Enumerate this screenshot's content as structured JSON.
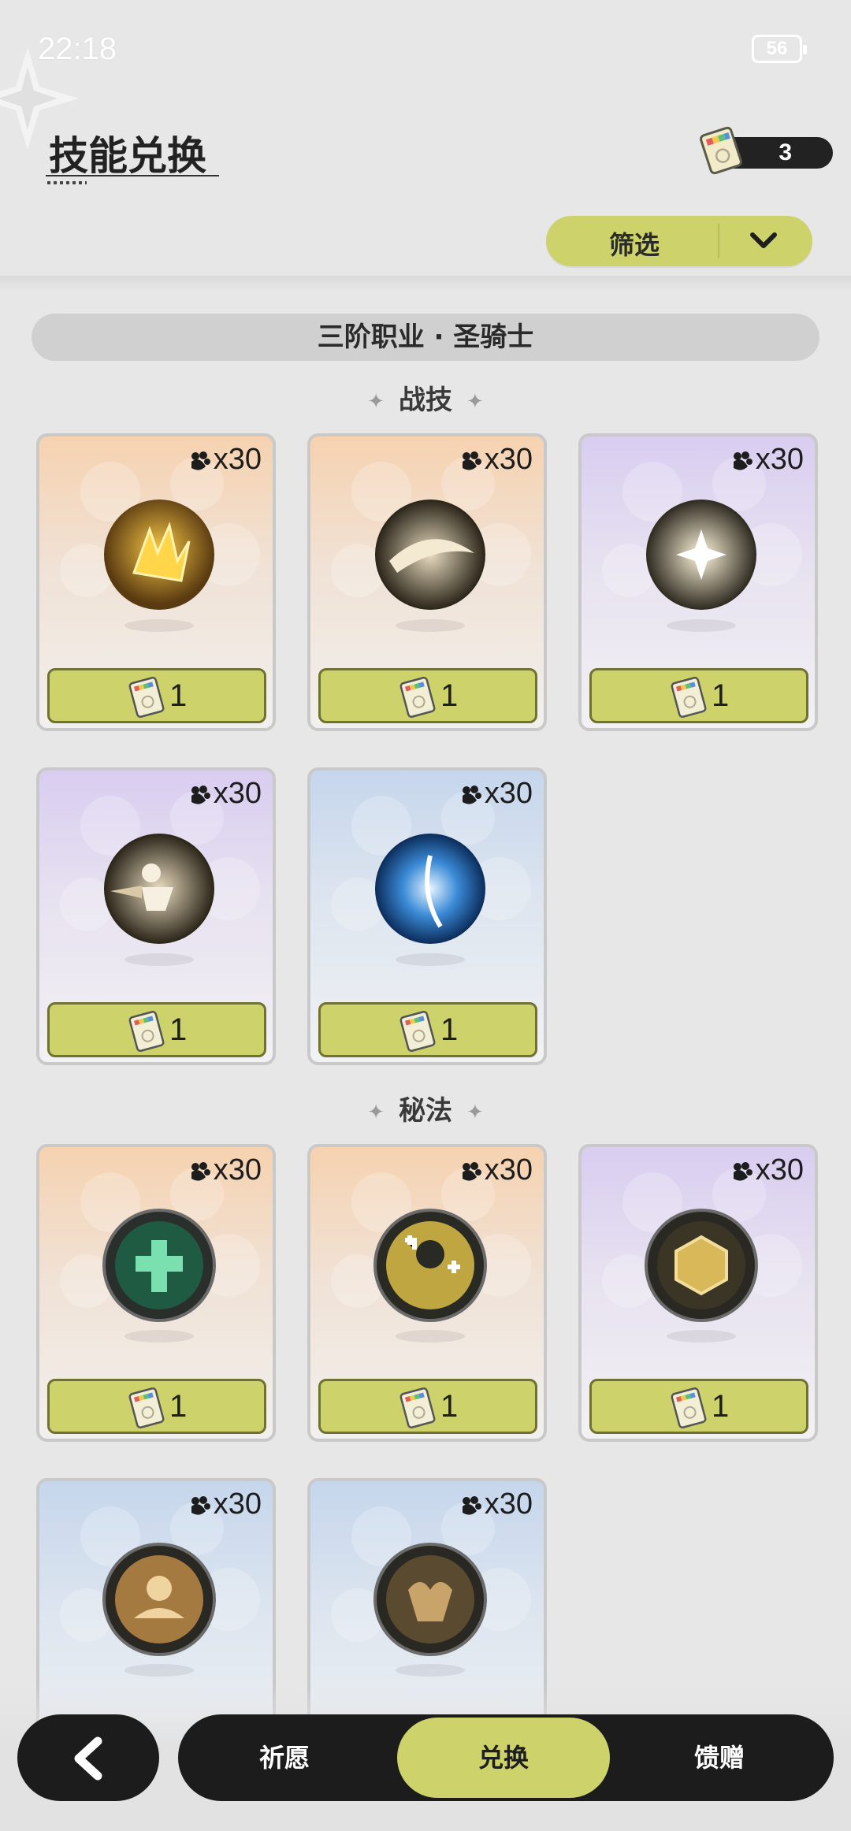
{
  "status_bar": {
    "time": "22:18",
    "battery": "56"
  },
  "header": {
    "title": "技能兑换",
    "currency_count": "3"
  },
  "filter": {
    "label": "筛选"
  },
  "section": {
    "title": "三阶职业 · 圣骑士"
  },
  "groups": [
    {
      "label": "战技",
      "cards": [
        {
          "cost": "x30",
          "price": "1",
          "theme": "orange",
          "icon": "sword-flame-skill-icon"
        },
        {
          "cost": "x30",
          "price": "1",
          "theme": "orange",
          "icon": "slash-wave-skill-icon"
        },
        {
          "cost": "x30",
          "price": "1",
          "theme": "purple",
          "icon": "star-burst-skill-icon"
        },
        {
          "cost": "x30",
          "price": "1",
          "theme": "purple",
          "icon": "dash-strike-skill-icon"
        },
        {
          "cost": "x30",
          "price": "1",
          "theme": "blue",
          "icon": "ice-vortex-skill-icon"
        }
      ]
    },
    {
      "label": "秘法",
      "cards": [
        {
          "cost": "x30",
          "price": "1",
          "theme": "orange",
          "icon": "holy-cross-skill-icon"
        },
        {
          "cost": "x30",
          "price": "1",
          "theme": "orange",
          "icon": "heal-ally-skill-icon"
        },
        {
          "cost": "x30",
          "price": "1",
          "theme": "purple",
          "icon": "hex-shield-skill-icon"
        },
        {
          "cost": "x30",
          "price": "",
          "theme": "blue",
          "icon": "strength-buff-skill-icon"
        },
        {
          "cost": "x30",
          "price": "",
          "theme": "blue",
          "icon": "guard-hands-skill-icon"
        }
      ]
    }
  ],
  "nav": {
    "tabs": [
      "祈愿",
      "兑换",
      "馈赠"
    ],
    "active": "兑换"
  },
  "colors": {
    "accent": "#cdd26a",
    "dark": "#1c1c1c",
    "background": "#e7e7e7"
  }
}
